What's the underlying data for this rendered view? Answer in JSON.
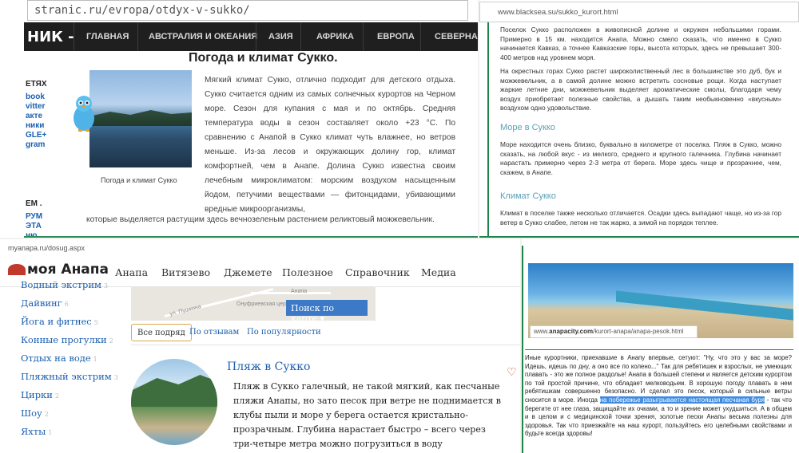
{
  "p1": {
    "url": "stranic.ru/evropa/otdyx-v-sukko/",
    "logo": "НИК -",
    "nav": [
      "ГЛАВНАЯ",
      "АВСТРАЛИЯ И ОКЕАНИЯ",
      "АЗИЯ",
      "АФРИКА",
      "ЕВРОПА",
      "СЕВЕРНА"
    ],
    "side_head1": "ЕТЯХ",
    "side_links": [
      "book",
      "vitter",
      "акте",
      "ники",
      "GLE+",
      "gram"
    ],
    "side_head2": "ЕМ .",
    "side_links2": [
      "РУМ",
      "ЭТА",
      "ню"
    ],
    "title": "Погода и климат Сукко.",
    "caption": "Погода и климат Сукко",
    "body": "Мягкий климат Сукко, отлично подходит для детского отдыха. Сукко считается одним из самых солнечных курортов на Черном море. Сезон для купания с мая и по октябрь. Средняя температура воды в сезон составляет около +23 °C. По сравнению с Анапой в Сукко климат чуть влажнее, но ветров меньше. Из-за лесов и окружающих долину гор, климат комфортней, чем в Анапе. Долина Сукко известна своим лечебным микроклиматом: морским воздухом насыщенным йодом, петучими веществами — фитонцидами, убивающими вредные микроорганизмы,",
    "last_line": "которые выделяется растущим здесь вечнозеленым растением реликтовый можжевельник."
  },
  "p2": {
    "url": "www.blacksea.su/sukko_kurort.html",
    "para1": "Поселок Сукко расположен в живописной долине и окружен небольшими горами. Примерно в 15 км. находится Анапа. Можно смело сказать, что именно в Сукко начинается Кавказ, а точнее Кавказские горы, высота которых, здесь не превышает 300-400 метров над уровнем моря.",
    "para2": "На окрестных горах Сукко растет широколиственный лес в большинстве это дуб, бук и можжевельник, а в самой долине можно встретить сосновые рощи. Когда наступает жаркие летние дни, можжевельник выделяет ароматические смолы, благодаря чему воздух приобретает полезные свойства, а дышать таким необыкновенно «вкусным» воздухом одно удовольствие.",
    "h1": "Море в Сукко",
    "para3": "Море находится очень близко, буквально в километре от поселка. Пляж в Сукко, можно сказать, на любой вкус - из мелкого, среднего и крупного галечника. Глубина начинает нарастать примерно через 2-3 метра от берега. Море здесь чище и прозрачнее, чем, скажем, в Анапе.",
    "h2": "Климат Сукко",
    "para4": "Климат в поселке также несколько отличается. Осадки здесь выпадают чаще, но из-за гор ветер в Сукко слабее, летом не так жарко, а зимой на порядок теплее."
  },
  "p3": {
    "url": "myanapa.ru/dosug.aspx",
    "logo": "моя Анапа",
    "nav": [
      "Анапа",
      "Витязево",
      "Джемете",
      "Полезное",
      "Справочник",
      "Медиа"
    ],
    "list": [
      {
        "label": "Водный экстрим",
        "count": "3"
      },
      {
        "label": "Дайвинг",
        "count": "6"
      },
      {
        "label": "Йога и фитнес",
        "count": "5"
      },
      {
        "label": "Конные прогулки",
        "count": "2"
      },
      {
        "label": "Отдых на воде",
        "count": "1"
      },
      {
        "label": "Пляжный экстрим",
        "count": "3"
      },
      {
        "label": "Цирки",
        "count": "2"
      },
      {
        "label": "Шоу",
        "count": "2"
      },
      {
        "label": "Яхты",
        "count": "1"
      }
    ],
    "map_labels": [
      "ул. Пушкина",
      "Онуфриевская церковь",
      "Анапа"
    ],
    "map_button": "Поиск по карте",
    "tabs": [
      "Все подряд",
      "По отзывам",
      "По популярности"
    ],
    "place_title": "Пляж в Сукко",
    "place_text": "Пляж в Сукко галечный, не такой мягкий, как песчаные пляжи Анапы, но зато песок при ветре не поднимается в клубы пыли и море у берега остается кристально-прозрачным. Глубина нарастает быстро – всего через три-четыре метра можно погрузиться в воду"
  },
  "p4": {
    "url_prefix": "www.",
    "url_domain": "anapacity.com",
    "url_path": "/kurort-anapa/anapa-pesok.html",
    "text_before": "Иные курортники, приехавшие в Анапу впервые, сетуют: \"Ну, что это у вас за море? Идешь, идешь по дну, а оно все по колено...\" Так для ребятишек и взрослых, не умеющих плавать - это же полное раздолье! Анапа в большей степени и является детским курортом по той простой причине, что обладает мелководьем. В хорошую погоду плавать в нем ребятишкам совершенно безопасно. И сделал это песок, который в сильные ветры сносится в море. Иногда ",
    "text_highlight": "на побережье разыгрывается настоящая песчаная буря",
    "text_after": " - так что берегите от нее глаза, защищайте их очками, а то и зрение может ухудшиться. А в общем и в целом и с медицинской точки зрения, золотые пески Анапы весьма полезны для здоровья. Так что приезжайте на наш курорт, пользуйтесь его целебными свойствами и будьте всегда здоровы!"
  }
}
